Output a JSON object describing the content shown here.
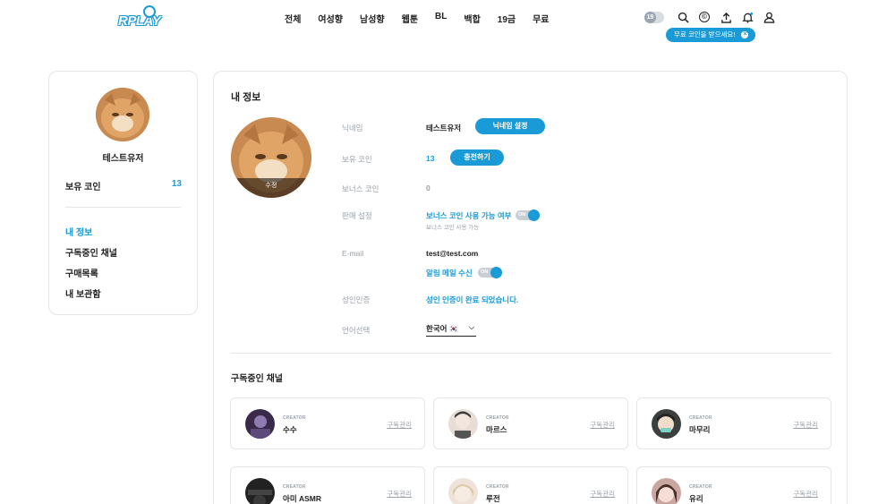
{
  "header": {
    "logo_text": "RPLAY",
    "nav": [
      "전체",
      "여성향",
      "남성향",
      "웹툰",
      "BL",
      "백합",
      "19금",
      "무료"
    ],
    "adult_badge": "19",
    "coin_icon_glyph": "©",
    "free_coin_banner": "무료 코인을 받으세요!",
    "free_coin_close": "×",
    "icons": [
      "search-icon",
      "coin-icon",
      "upload-icon",
      "bell-icon",
      "user-icon"
    ]
  },
  "sidebar": {
    "name": "테스트유저",
    "coin_label": "보유 코인",
    "coin_value": "13",
    "menu": [
      "내 정보",
      "구독중인 채널",
      "구매목록",
      "내 보관함"
    ],
    "active_index": 0
  },
  "profile": {
    "title": "내 정보",
    "avatar_edit": "수정",
    "nickname_label": "닉네임",
    "nickname_value": "테스트유저",
    "nickname_button": "닉네임 설정",
    "coin_label": "보유 코인",
    "coin_value": "13",
    "charge_button": "충전하기",
    "bonus_label": "보너스 코인",
    "bonus_value": "0",
    "sale_label": "판매 설정",
    "sale_value": "보너스 코인 사용 가능 여부",
    "sale_note": "보너스 코인 사용 가능",
    "sale_toggle": "ON",
    "email_label": "E-mail",
    "email_value": "test@test.com",
    "mail_alert_label": "알림 메일 수신",
    "mail_toggle": "ON",
    "adult_label": "성인인증",
    "adult_value": "성인 인증이 완료 되었습니다.",
    "lang_label": "언어선택",
    "lang_value": "한국어 🇰🇷",
    "lang_chevron": "⌵"
  },
  "subscriptions": {
    "title": "구독중인 채널",
    "tag": "CREATOR",
    "manage_label": "구독관리",
    "channels": [
      {
        "name": "수수",
        "color": "#3a2a4a"
      },
      {
        "name": "마르스",
        "color": "#e8ddd6"
      },
      {
        "name": "마무리",
        "color": "#3b3f3e"
      },
      {
        "name": "아미 ASMR",
        "color": "#222222"
      },
      {
        "name": "루전",
        "color": "#efe2d8"
      },
      {
        "name": "유리",
        "color": "#caa6a0"
      }
    ]
  },
  "colors": {
    "accent": "#1a9ad6",
    "muted": "#9aa1a9",
    "border": "#e3e6ea"
  }
}
